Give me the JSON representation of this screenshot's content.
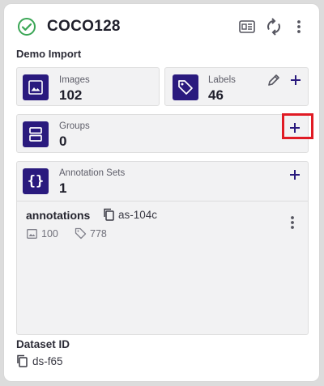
{
  "header": {
    "title": "COCO128",
    "subtitle": "Demo Import",
    "status_color": "#3aa655",
    "icons": [
      "check-circle-icon",
      "image-grid-icon",
      "refresh-icon",
      "more-vert-icon"
    ]
  },
  "stats": {
    "images": {
      "label": "Images",
      "value": "102"
    },
    "labels": {
      "label": "Labels",
      "value": "46"
    },
    "groups": {
      "label": "Groups",
      "value": "0"
    },
    "annotation_sets": {
      "label": "Annotation Sets",
      "value": "1"
    }
  },
  "annotation_item": {
    "name": "annotations",
    "id": "as-104c",
    "image_count": "100",
    "label_count": "778"
  },
  "dataset": {
    "id_label": "Dataset ID",
    "id_value": "ds-f65"
  },
  "colors": {
    "accent": "#2a1a7e",
    "highlight": "#e01b24"
  }
}
